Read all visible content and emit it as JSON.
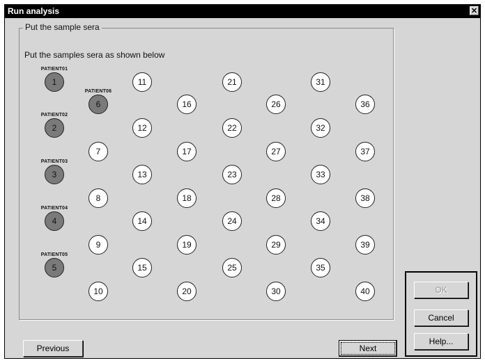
{
  "window": {
    "title": "Run analysis",
    "close_glyph": "✕"
  },
  "group": {
    "legend": "Put the sample sera",
    "instruction": "Put the samples sera as shown below"
  },
  "patients": [
    {
      "label": "PATIENT01",
      "number": "1"
    },
    {
      "label": "PATIENT02",
      "number": "2"
    },
    {
      "label": "PATIENT03",
      "number": "3"
    },
    {
      "label": "PATIENT04",
      "number": "4"
    },
    {
      "label": "PATIENT05",
      "number": "5"
    },
    {
      "label": "PATIENT06",
      "number": "6"
    }
  ],
  "wells": [
    "7",
    "8",
    "9",
    "10",
    "11",
    "12",
    "13",
    "14",
    "15",
    "16",
    "17",
    "18",
    "19",
    "20",
    "21",
    "22",
    "23",
    "24",
    "25",
    "26",
    "27",
    "28",
    "29",
    "30",
    "31",
    "32",
    "33",
    "34",
    "35",
    "36",
    "37",
    "38",
    "39",
    "40"
  ],
  "buttons": {
    "previous": "Previous",
    "next": "Next",
    "ok": "OK",
    "cancel": "Cancel",
    "help": "Help..."
  },
  "colors": {
    "filled_well": "#7a7a7a",
    "titlebar": "#000000",
    "dialog_bg": "#d6d6d6"
  }
}
